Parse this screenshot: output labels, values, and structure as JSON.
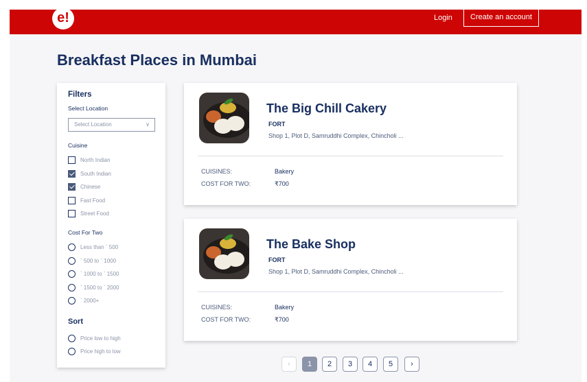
{
  "header": {
    "logo_text": "e!",
    "login_label": "Login",
    "create_account_label": "Create an account",
    "brand_color": "#ce0505"
  },
  "page": {
    "title": "Breakfast Places in Mumbai"
  },
  "filters": {
    "title": "Filters",
    "location_label": "Select Location",
    "location_placeholder": "Select Location",
    "cuisine_label": "Cuisine",
    "cuisines": [
      {
        "label": "North Indian",
        "checked": false
      },
      {
        "label": "South Indian",
        "checked": true
      },
      {
        "label": "Chinese",
        "checked": true
      },
      {
        "label": "Fast Food",
        "checked": false
      },
      {
        "label": "Street Food",
        "checked": false
      }
    ],
    "cost_label": "Cost For Two",
    "costs": [
      "Less than ` 500",
      "` 500 to ` 1000",
      "` 1000 to ` 1500",
      "` 1500 to ` 2000",
      "` 2000+"
    ],
    "sort_label": "Sort",
    "sorts": [
      "Price low to high",
      "Price high to low"
    ]
  },
  "restaurants": [
    {
      "name": "The Big Chill Cakery",
      "area": "FORT",
      "address": "Shop 1, Plot D, Samruddhi Complex, Chincholi ...",
      "cuisines_label": "CUISINES:",
      "cuisines_value": "Bakery",
      "cost_label": "COST FOR TWO:",
      "cost_value": "₹700"
    },
    {
      "name": "The Bake Shop",
      "area": "FORT",
      "address": "Shop 1, Plot D, Samruddhi Complex, Chincholi ...",
      "cuisines_label": "CUISINES:",
      "cuisines_value": "Bakery",
      "cost_label": "COST FOR TWO:",
      "cost_value": "₹700"
    }
  ],
  "pagination": {
    "prev": "‹",
    "next": "›",
    "pages": [
      "1",
      "2",
      "3",
      "4",
      "5"
    ],
    "current": "1"
  },
  "icons": [
    "chevron-down-icon",
    "checkbox-icon",
    "radio-icon",
    "chevron-left-icon",
    "chevron-right-icon"
  ]
}
